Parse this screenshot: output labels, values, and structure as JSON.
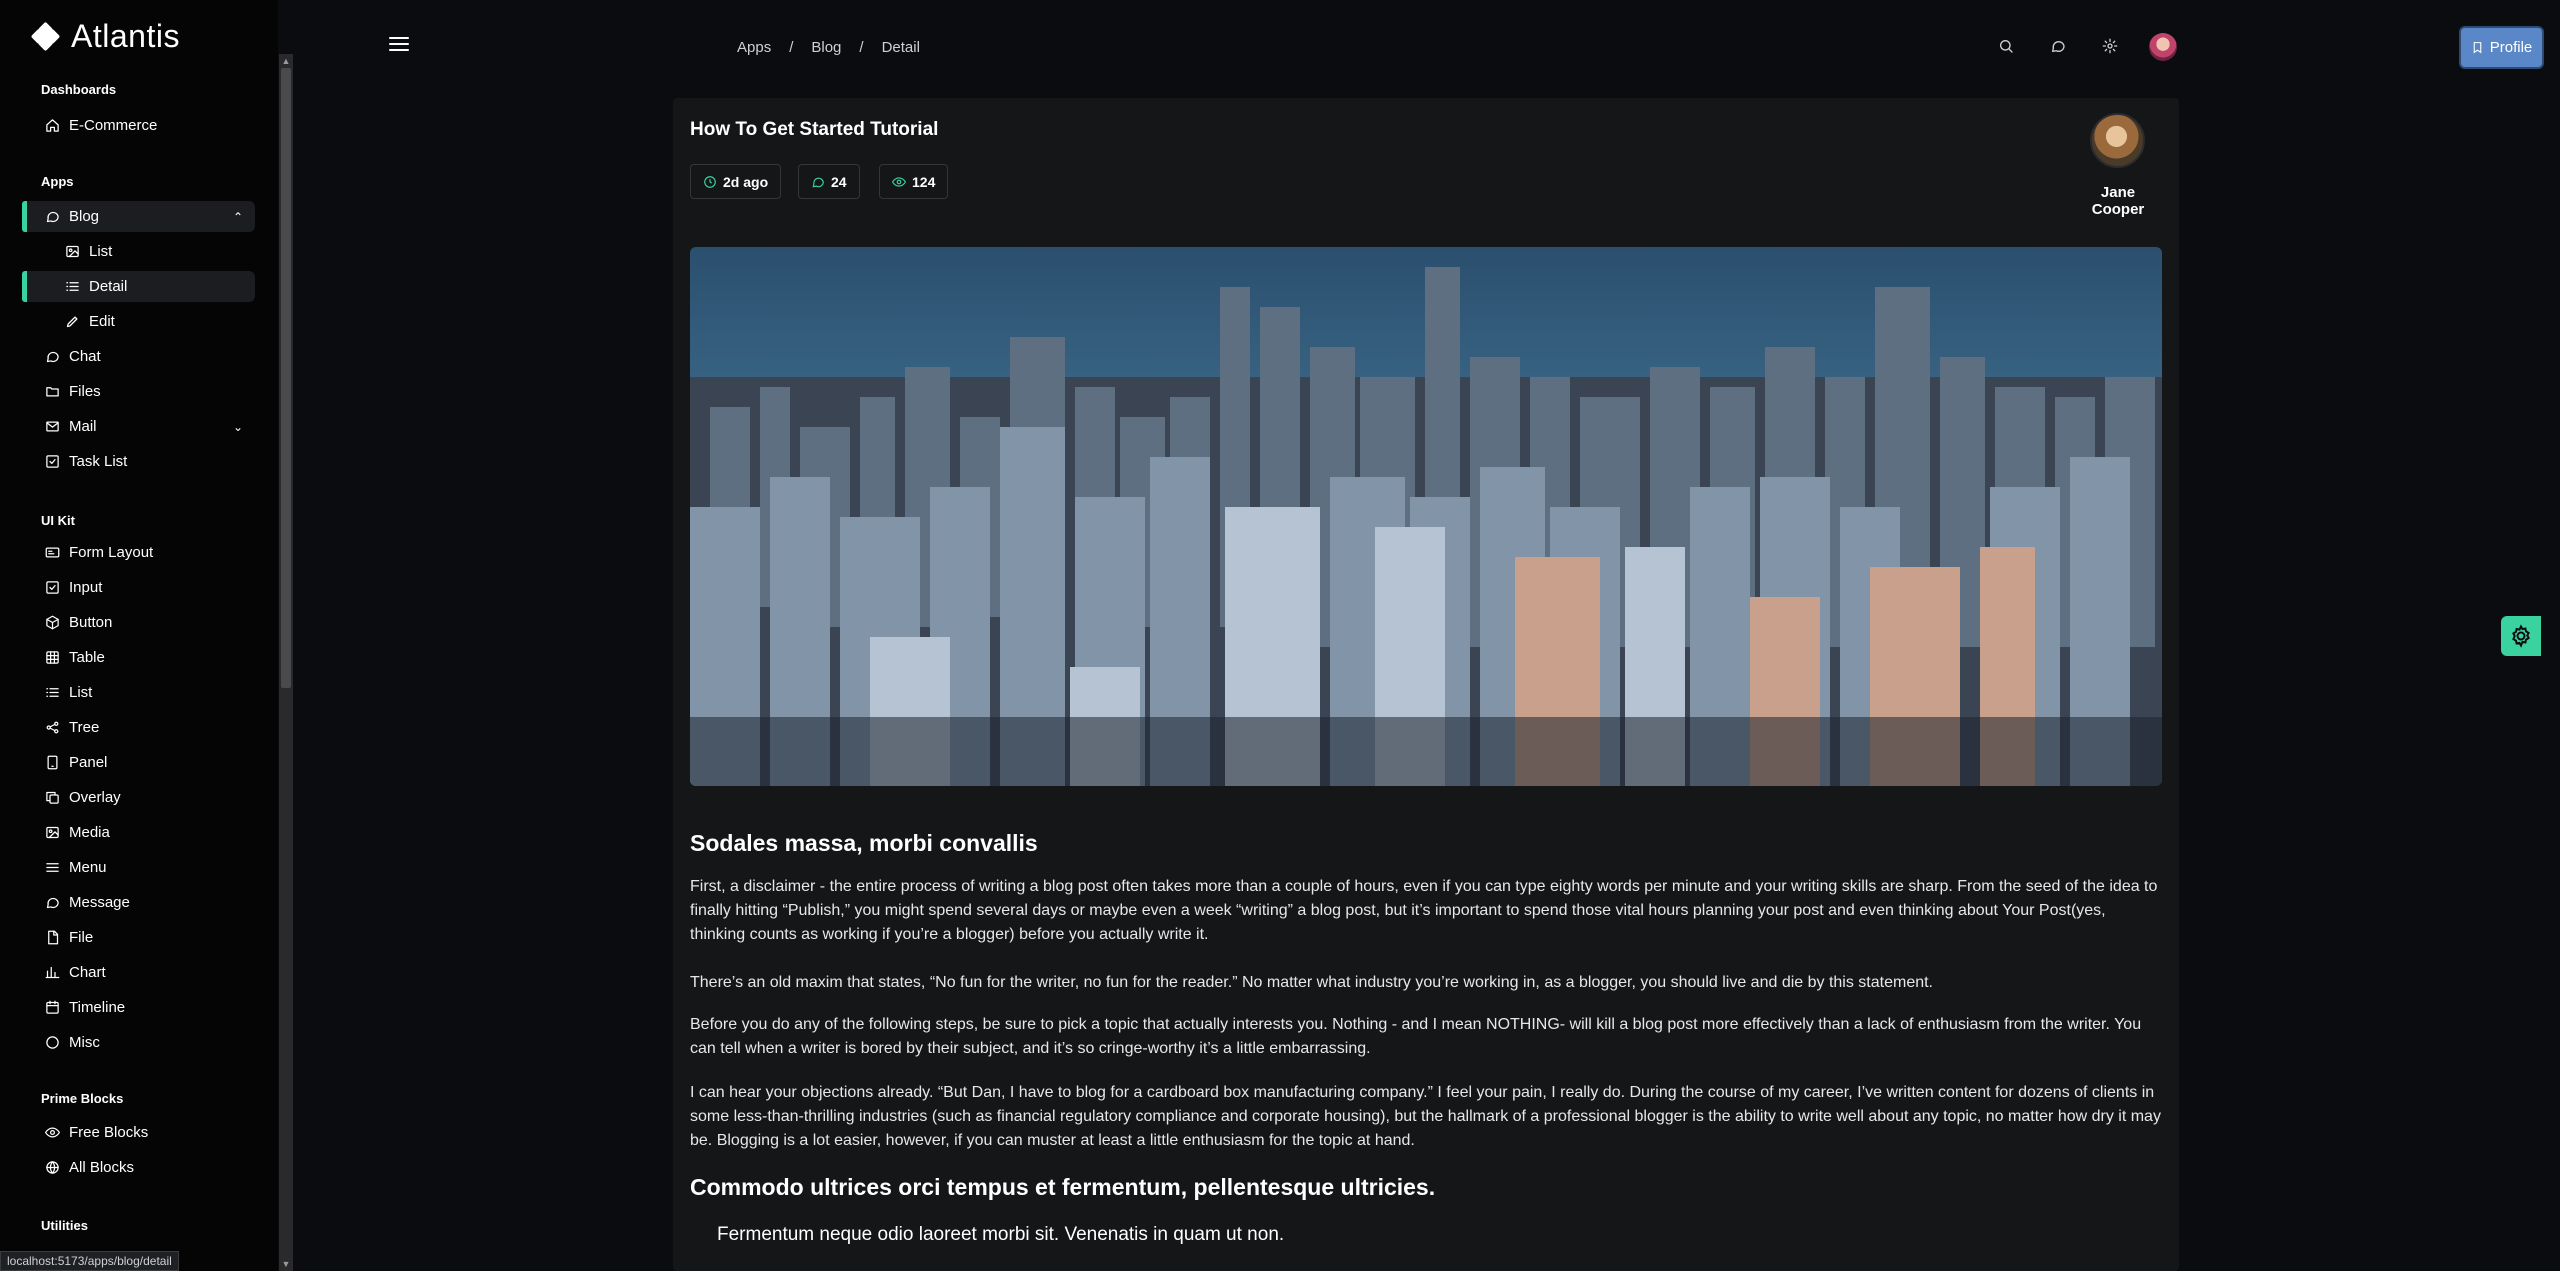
{
  "app": {
    "name": "Atlantis"
  },
  "sidebar": {
    "sections": [
      {
        "title": "Dashboards",
        "items": [
          {
            "label": "E-Commerce",
            "icon": "home-icon"
          }
        ]
      },
      {
        "title": "Apps",
        "items": [
          {
            "label": "Blog",
            "icon": "chat-bubble-icon",
            "expanded": true
          },
          {
            "label": "List",
            "icon": "image-icon",
            "sub": true
          },
          {
            "label": "Detail",
            "icon": "list-icon",
            "sub": true,
            "active": true
          },
          {
            "label": "Edit",
            "icon": "pencil-icon",
            "sub": true
          },
          {
            "label": "Chat",
            "icon": "comments-icon"
          },
          {
            "label": "Files",
            "icon": "folder-icon"
          },
          {
            "label": "Mail",
            "icon": "envelope-icon"
          },
          {
            "label": "Task List",
            "icon": "check-square-icon"
          }
        ]
      },
      {
        "title": "UI Kit",
        "items": [
          {
            "label": "Form Layout",
            "icon": "id-card-icon"
          },
          {
            "label": "Input",
            "icon": "check-square-icon"
          },
          {
            "label": "Button",
            "icon": "box-icon"
          },
          {
            "label": "Table",
            "icon": "table-icon"
          },
          {
            "label": "List",
            "icon": "list-icon"
          },
          {
            "label": "Tree",
            "icon": "share-alt-icon"
          },
          {
            "label": "Panel",
            "icon": "tablet-icon"
          },
          {
            "label": "Overlay",
            "icon": "clone-icon"
          },
          {
            "label": "Media",
            "icon": "image-icon"
          },
          {
            "label": "Menu",
            "icon": "bars-icon"
          },
          {
            "label": "Message",
            "icon": "comment-icon"
          },
          {
            "label": "File",
            "icon": "file-icon"
          },
          {
            "label": "Chart",
            "icon": "chart-bar-icon"
          },
          {
            "label": "Timeline",
            "icon": "calendar-icon"
          },
          {
            "label": "Misc",
            "icon": "circle-icon"
          }
        ]
      },
      {
        "title": "Prime Blocks",
        "items": [
          {
            "label": "Free Blocks",
            "icon": "eye-icon"
          },
          {
            "label": "All Blocks",
            "icon": "globe-icon"
          }
        ]
      },
      {
        "title": "Utilities",
        "items": []
      }
    ]
  },
  "topbar": {
    "breadcrumb": [
      "Apps",
      "Blog",
      "Detail"
    ],
    "profile_label": "Profile"
  },
  "post": {
    "title": "How To Get Started Tutorial",
    "time": "2d ago",
    "comments": "24",
    "views": "124",
    "author": "Jane Cooper",
    "section1_title": "Sodales massa, morbi convallis",
    "para1": "First, a disclaimer - the entire process of writing a blog post often takes more than a couple of hours, even if you can type eighty words per minute and your writing skills are sharp. From the seed of the idea to finally hitting “Publish,” you might spend several days or maybe even a week “writing” a blog post, but it’s important to spend those vital hours planning your post and even thinking about Your Post(yes, thinking counts as working if you’re a blogger) before you actually write it.",
    "para2": "There’s an old maxim that states, “No fun for the writer, no fun for the reader.” No matter what industry you’re working in, as a blogger, you should live and die by this statement.",
    "para3": "Before you do any of the following steps, be sure to pick a topic that actually interests you. Nothing - and I mean NOTHING- will kill a blog post more effectively than a lack of enthusiasm from the writer. You can tell when a writer is bored by their subject, and it’s so cringe-worthy it’s a little embarrassing.",
    "para4": "I can hear your objections already. “But Dan, I have to blog for a cardboard box manufacturing company.” I feel your pain, I really do. During the course of my career, I’ve written content for dozens of clients in some less-than-thrilling industries (such as financial regulatory compliance and corporate housing), but the hallmark of a professional blogger is the ability to write well about any topic, no matter how dry it may be. Blogging is a lot easier, however, if you can muster at least a little enthusiasm for the topic at hand.",
    "section2_title": "Commodo ultrices orci tempus et fermentum, pellentesque ultricies.",
    "quote": "Fermentum neque odio laoreet morbi sit. Venenatis in quam ut non."
  },
  "status_url": "localhost:5173/apps/blog/detail",
  "colors": {
    "accent": "#3ad29f",
    "background": "#0b0c0f",
    "card": "#151618",
    "profile_button": "#5a87c7"
  }
}
